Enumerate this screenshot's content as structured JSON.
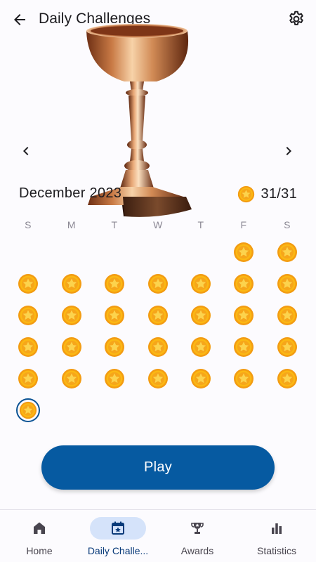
{
  "header": {
    "title": "Daily Challenges",
    "back_icon": "arrow-left-icon",
    "settings_icon": "gear-icon"
  },
  "hero": {
    "image": "trophy-cup",
    "tier": "bronze"
  },
  "calendar": {
    "month": "December",
    "year": "2023",
    "prev_icon": "chevron-left-icon",
    "next_icon": "chevron-right-icon",
    "progress_icon": "gold-coin-icon",
    "progress": "31/31",
    "weekdays": [
      "S",
      "M",
      "T",
      "W",
      "T",
      "F",
      "S"
    ],
    "first_weekday_index": 5,
    "days_in_month": 31,
    "completed_days": 31,
    "selected_day": 31
  },
  "play_button": {
    "label": "Play"
  },
  "bottom_nav": {
    "items": [
      {
        "label": "Home",
        "icon": "home-icon",
        "active": false
      },
      {
        "label": "Daily Challe...",
        "icon": "calendar-star-icon",
        "active": true
      },
      {
        "label": "Awards",
        "icon": "trophy-icon",
        "active": false
      },
      {
        "label": "Statistics",
        "icon": "bar-chart-icon",
        "active": false
      }
    ]
  },
  "colors": {
    "primary": "#065aa1",
    "active_pill": "#d5e3fa",
    "coin_gold": "#fbb813",
    "coin_orange": "#f39c12",
    "selected_ring": "#0b5394"
  }
}
